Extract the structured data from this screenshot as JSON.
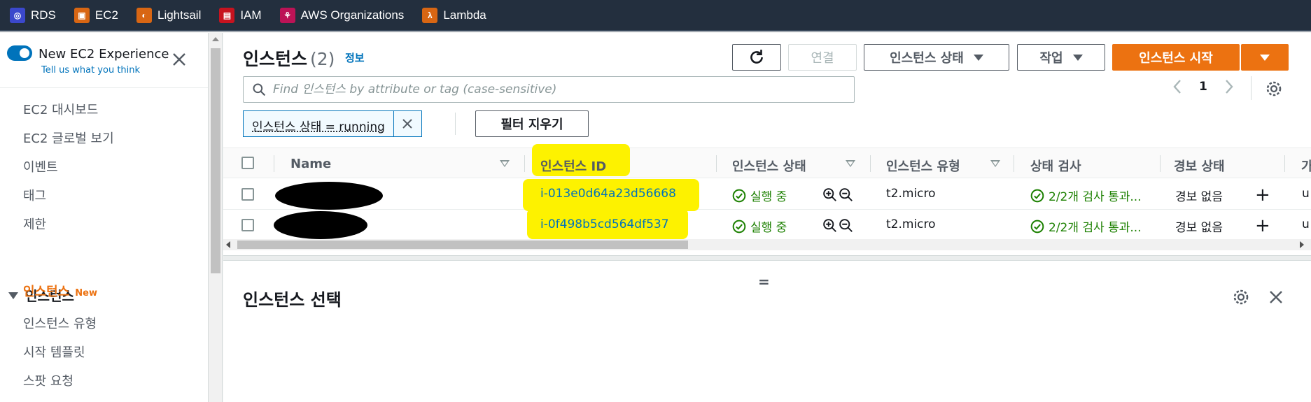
{
  "bookmarks": [
    {
      "label": "RDS",
      "icon": "rds-icon",
      "color": "#3b48cc"
    },
    {
      "label": "EC2",
      "icon": "ec2-icon",
      "color": "#d86613"
    },
    {
      "label": "Lightsail",
      "icon": "lightsail-icon",
      "color": "#d86613"
    },
    {
      "label": "IAM",
      "icon": "iam-icon",
      "color": "#c7131f"
    },
    {
      "label": "AWS Organizations",
      "icon": "organizations-icon",
      "color": "#bc1356"
    },
    {
      "label": "Lambda",
      "icon": "lambda-icon",
      "color": "#d86613"
    }
  ],
  "sidebar": {
    "experience_title": "New EC2 Experience",
    "experience_link": "Tell us what you think",
    "experience_enabled": true,
    "items": [
      "EC2 대시보드",
      "EC2 글로벌 보기",
      "이벤트",
      "태그",
      "제한"
    ],
    "section": "인스턴스",
    "section_items": [
      {
        "label": "인스턴스",
        "badge": "New",
        "active": true
      },
      {
        "label": "인스턴스 유형"
      },
      {
        "label": "시작 템플릿"
      },
      {
        "label": "스팟 요청"
      }
    ]
  },
  "header": {
    "title": "인스턴스",
    "count": "(2)",
    "info": "정보",
    "connect_label": "연결",
    "state_label": "인스턴스 상태",
    "actions_label": "작업",
    "launch_label": "인스턴스 시작",
    "accent": "#ec7211"
  },
  "search": {
    "placeholder": "Find 인스턴스 by attribute or tag (case-sensitive)",
    "value": ""
  },
  "pagination": {
    "page": "1"
  },
  "filter": {
    "token": "인스턴스 상태 = running",
    "clear_label": "필터 지우기"
  },
  "table": {
    "columns": [
      "Name",
      "인스턴스 ID",
      "인스턴스 상태",
      "인스턴스 유형",
      "상태 검사",
      "경보 상태",
      "가"
    ],
    "rows": [
      {
        "name": "",
        "id": "i-013e0d64a23d56668",
        "state": "실행 중",
        "type": "t2.micro",
        "check": "2/2개 검사 통과...",
        "alarm": "경보 없음",
        "extra": "u"
      },
      {
        "name": "",
        "id": "i-0f498b5cd564df537",
        "state": "실행 중",
        "type": "t2.micro",
        "check": "2/2개 검사 통과...",
        "alarm": "경보 없음",
        "extra": "u"
      }
    ]
  },
  "panel": {
    "drag_handle": "=",
    "title": "인스턴스 선택"
  }
}
